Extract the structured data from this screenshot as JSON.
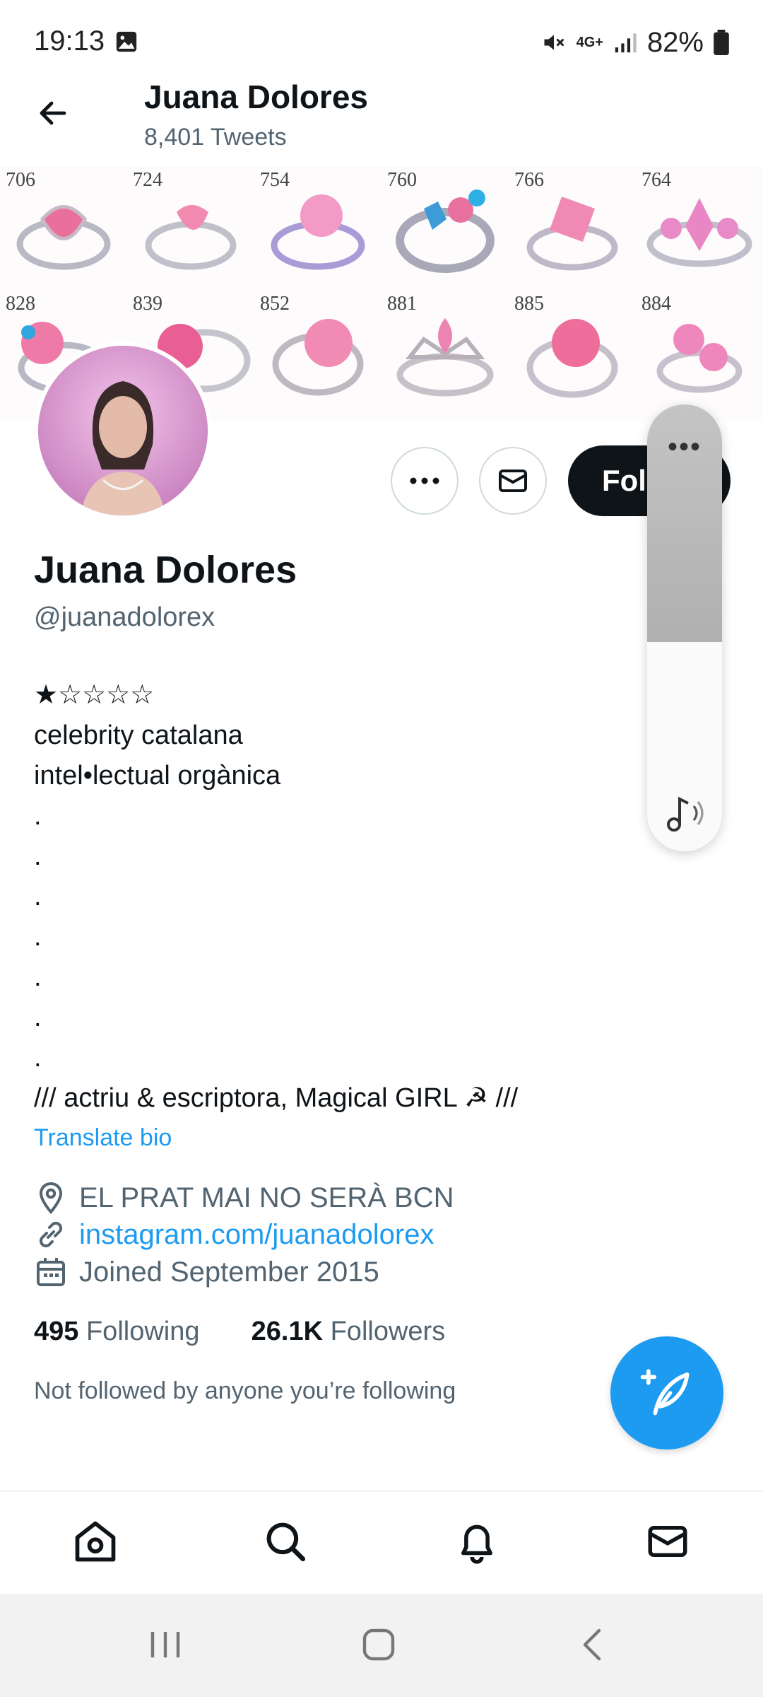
{
  "status_bar": {
    "time": "19:13",
    "network": "4G+",
    "battery": "82%"
  },
  "header": {
    "name": "Juana Dolores",
    "tweets_count": "8,401 Tweets"
  },
  "banner": {
    "ring_numbers": [
      "706",
      "724",
      "754",
      "760",
      "766",
      "764",
      "828",
      "839",
      "852",
      "881",
      "885",
      "884"
    ]
  },
  "actions": {
    "follow_label": "Fol",
    "panel_dots": "•••"
  },
  "profile": {
    "display_name": "Juana Dolores",
    "handle": "@juanadolorex",
    "bio_lines": [
      "★☆☆☆☆",
      "celebrity catalana",
      "intel•lectual orgànica",
      ".",
      ".",
      ".",
      ".",
      ".",
      ".",
      ".",
      "/// actriu & escriptora, Magical GIRL ☭ ///"
    ],
    "translate_label": "Translate bio",
    "location": "EL PRAT MAI NO SERÀ BCN",
    "link": "instagram.com/juanadolorex",
    "joined": "Joined September 2015",
    "following_count": "495",
    "following_label": "Following",
    "followers_count": "26.1K",
    "followers_label": "Followers",
    "mutuals_note": "Not followed by anyone you’re following"
  },
  "colors": {
    "accent": "#1d9bf0",
    "text": "#0f1419",
    "muted": "#536471",
    "button_dark": "#0f1419"
  },
  "icons": {
    "back": "arrow-left-icon",
    "more": "more-horizontal-icon",
    "message": "envelope-icon",
    "location": "location-pin-icon",
    "link": "link-icon",
    "calendar": "calendar-icon",
    "compose": "compose-feather-icon",
    "home": "home-icon",
    "search": "search-icon",
    "notifications": "bell-icon",
    "messages": "envelope-icon"
  }
}
